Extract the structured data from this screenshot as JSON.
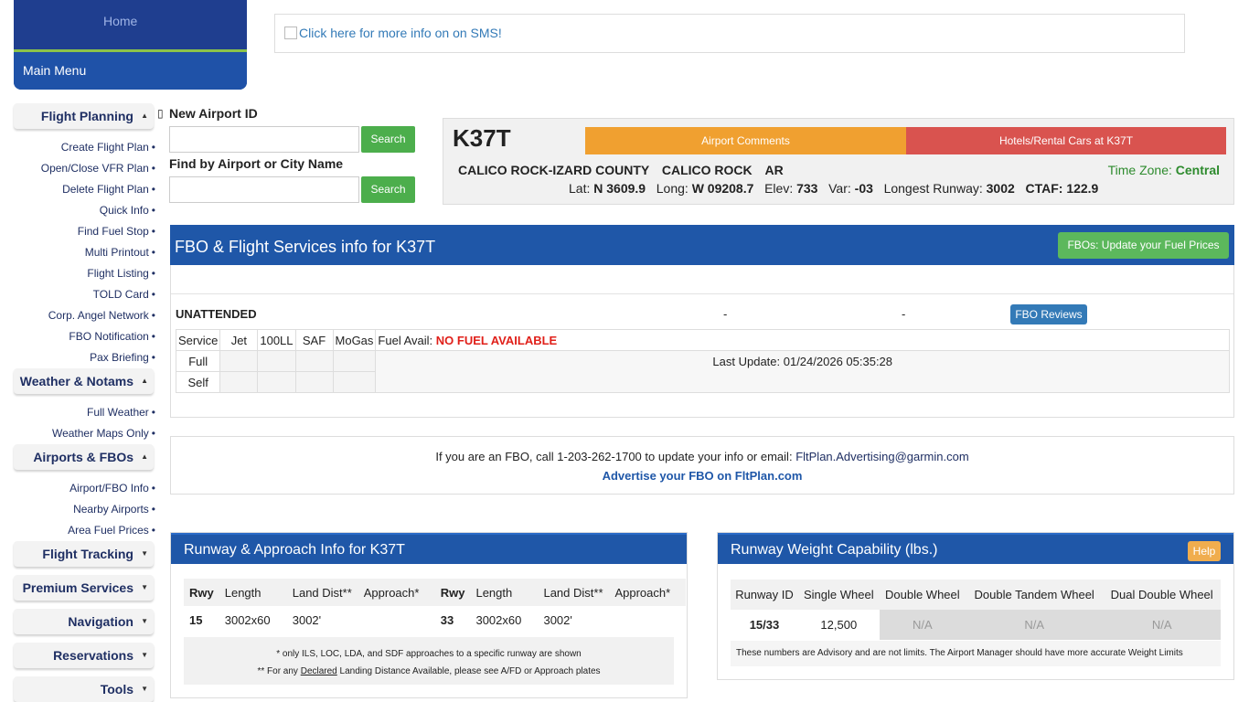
{
  "header": {
    "logo_alt": "Home",
    "main_menu_label": "Main Menu",
    "sms_link_text": "Click here for more info on on SMS!"
  },
  "sidebar": {
    "sections": [
      {
        "label": "Flight Planning",
        "caret": "▲",
        "items": [
          "Create Flight Plan",
          "Open/Close VFR Plan",
          "Delete Flight Plan",
          "Quick Info",
          "Find Fuel Stop",
          "Multi Printout",
          "Flight Listing",
          "TOLD Card",
          "Corp. Angel Network",
          "FBO Notification",
          "Pax Briefing"
        ]
      },
      {
        "label": "Weather & Notams",
        "caret": "▲",
        "items": [
          "Full Weather",
          "Weather Maps Only"
        ]
      },
      {
        "label": "Airports & FBOs",
        "caret": "▲",
        "items": [
          "Airport/FBO Info",
          "Nearby Airports",
          "Area Fuel Prices"
        ]
      },
      {
        "label": "Flight Tracking",
        "caret": "▼",
        "items": []
      },
      {
        "label": "Premium Services",
        "caret": "▼",
        "items": []
      },
      {
        "label": "Navigation",
        "caret": "▼",
        "items": []
      },
      {
        "label": "Reservations",
        "caret": "▼",
        "items": []
      },
      {
        "label": "Tools",
        "caret": "▼",
        "items": []
      }
    ],
    "bullet": "•"
  },
  "search": {
    "new_airport_label": "New Airport ID",
    "find_label": "Find by Airport or City Name",
    "search_button": "Search"
  },
  "airport": {
    "id": "K37T",
    "comments_button": "Airport Comments",
    "hotels_button": "Hotels/Rental Cars at K37T",
    "name": "CALICO ROCK-IZARD COUNTY",
    "city": "CALICO ROCK",
    "state": "AR",
    "tz_label": "Time Zone:",
    "tz_value": "Central",
    "lat_label": "Lat:",
    "lat": "N 3609.9",
    "long_label": "Long:",
    "long": "W 09208.7",
    "elev_label": "Elev:",
    "elev": "733",
    "var_label": "Var:",
    "var": "-03",
    "runway_label": "Longest Runway:",
    "runway": "3002",
    "ctaf_label": "CTAF:",
    "ctaf": "122.9",
    "colors": {
      "comments": "#f0a030",
      "hotels": "#d9534f",
      "tz": "#2e8b2e"
    }
  },
  "fbo": {
    "title": "FBO & Flight Services info for K37T",
    "update_button": "FBOs: Update your Fuel Prices",
    "name": "UNATTENDED",
    "dash1": "-",
    "dash2": "-",
    "reviews_button": "FBO Reviews",
    "fuel_headers": [
      "Service",
      "Jet",
      "100LL",
      "SAF",
      "MoGas"
    ],
    "rows": [
      "Full",
      "Self"
    ],
    "fuel_avail_label": "Fuel Avail:",
    "fuel_avail_value": "NO FUEL AVAILABLE",
    "last_update": "Last Update: 01/24/2026 05:35:28"
  },
  "contact": {
    "line1_prefix": "If you are an FBO, call 1-203-262-1700 to update your info or email:",
    "email": "FltPlan.Advertising@garmin.com",
    "line2": "Advertise your FBO on FltPlan.com"
  },
  "runway_panel": {
    "title": "Runway & Approach Info for K37T",
    "headers": [
      "Rwy",
      "Length",
      "Land Dist**",
      "Approach*",
      "Rwy",
      "Length",
      "Land Dist**",
      "Approach*"
    ],
    "row": [
      "15",
      "3002x60",
      "3002'",
      "",
      "33",
      "3002x60",
      "3002'",
      ""
    ],
    "note1": "* only ILS, LOC, LDA, and SDF approaches to a specific runway are shown",
    "note2_a": "** For any",
    "note2_link": "Declared",
    "note2_b": "Landing Distance Available, please see A/FD or Approach plates"
  },
  "weight_panel": {
    "title": "Runway Weight Capability (lbs.)",
    "help_button": "Help",
    "headers": [
      "Runway ID",
      "Single Wheel",
      "Double Wheel",
      "Double Tandem Wheel",
      "Dual Double Wheel"
    ],
    "row": [
      "15/33",
      "12,500",
      "N/A",
      "N/A",
      "N/A"
    ],
    "note": "These numbers are Advisory and are not limits.   The Airport Manager should have more accurate Weight Limits"
  }
}
